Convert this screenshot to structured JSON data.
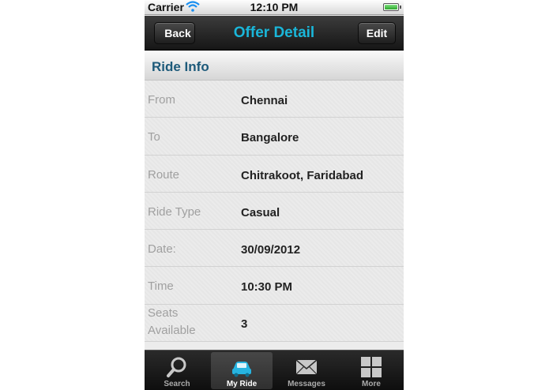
{
  "status_bar": {
    "carrier": "Carrier",
    "time": "12:10 PM"
  },
  "nav_bar": {
    "back_label": "Back",
    "title": "Offer Detail",
    "edit_label": "Edit"
  },
  "section": {
    "title": "Ride Info"
  },
  "rows": [
    {
      "label": "From",
      "value": "Chennai"
    },
    {
      "label": "To",
      "value": "Bangalore"
    },
    {
      "label": "Route",
      "value": "Chitrakoot, Faridabad"
    },
    {
      "label": "Ride Type",
      "value": "Casual"
    },
    {
      "label": "Date:",
      "value": "30/09/2012"
    },
    {
      "label": "Time",
      "value": "10:30 PM"
    },
    {
      "label": "Seats Available",
      "value": "3"
    }
  ],
  "tabs": [
    {
      "label": "Search",
      "icon": "search-icon",
      "active": false
    },
    {
      "label": "My Ride",
      "icon": "car-icon",
      "active": true
    },
    {
      "label": "Messages",
      "icon": "envelope-icon",
      "active": false
    },
    {
      "label": "More",
      "icon": "grid-icon",
      "active": false
    }
  ],
  "colors": {
    "title_accent": "#1ab6d9",
    "section_title": "#1d5a7a"
  }
}
